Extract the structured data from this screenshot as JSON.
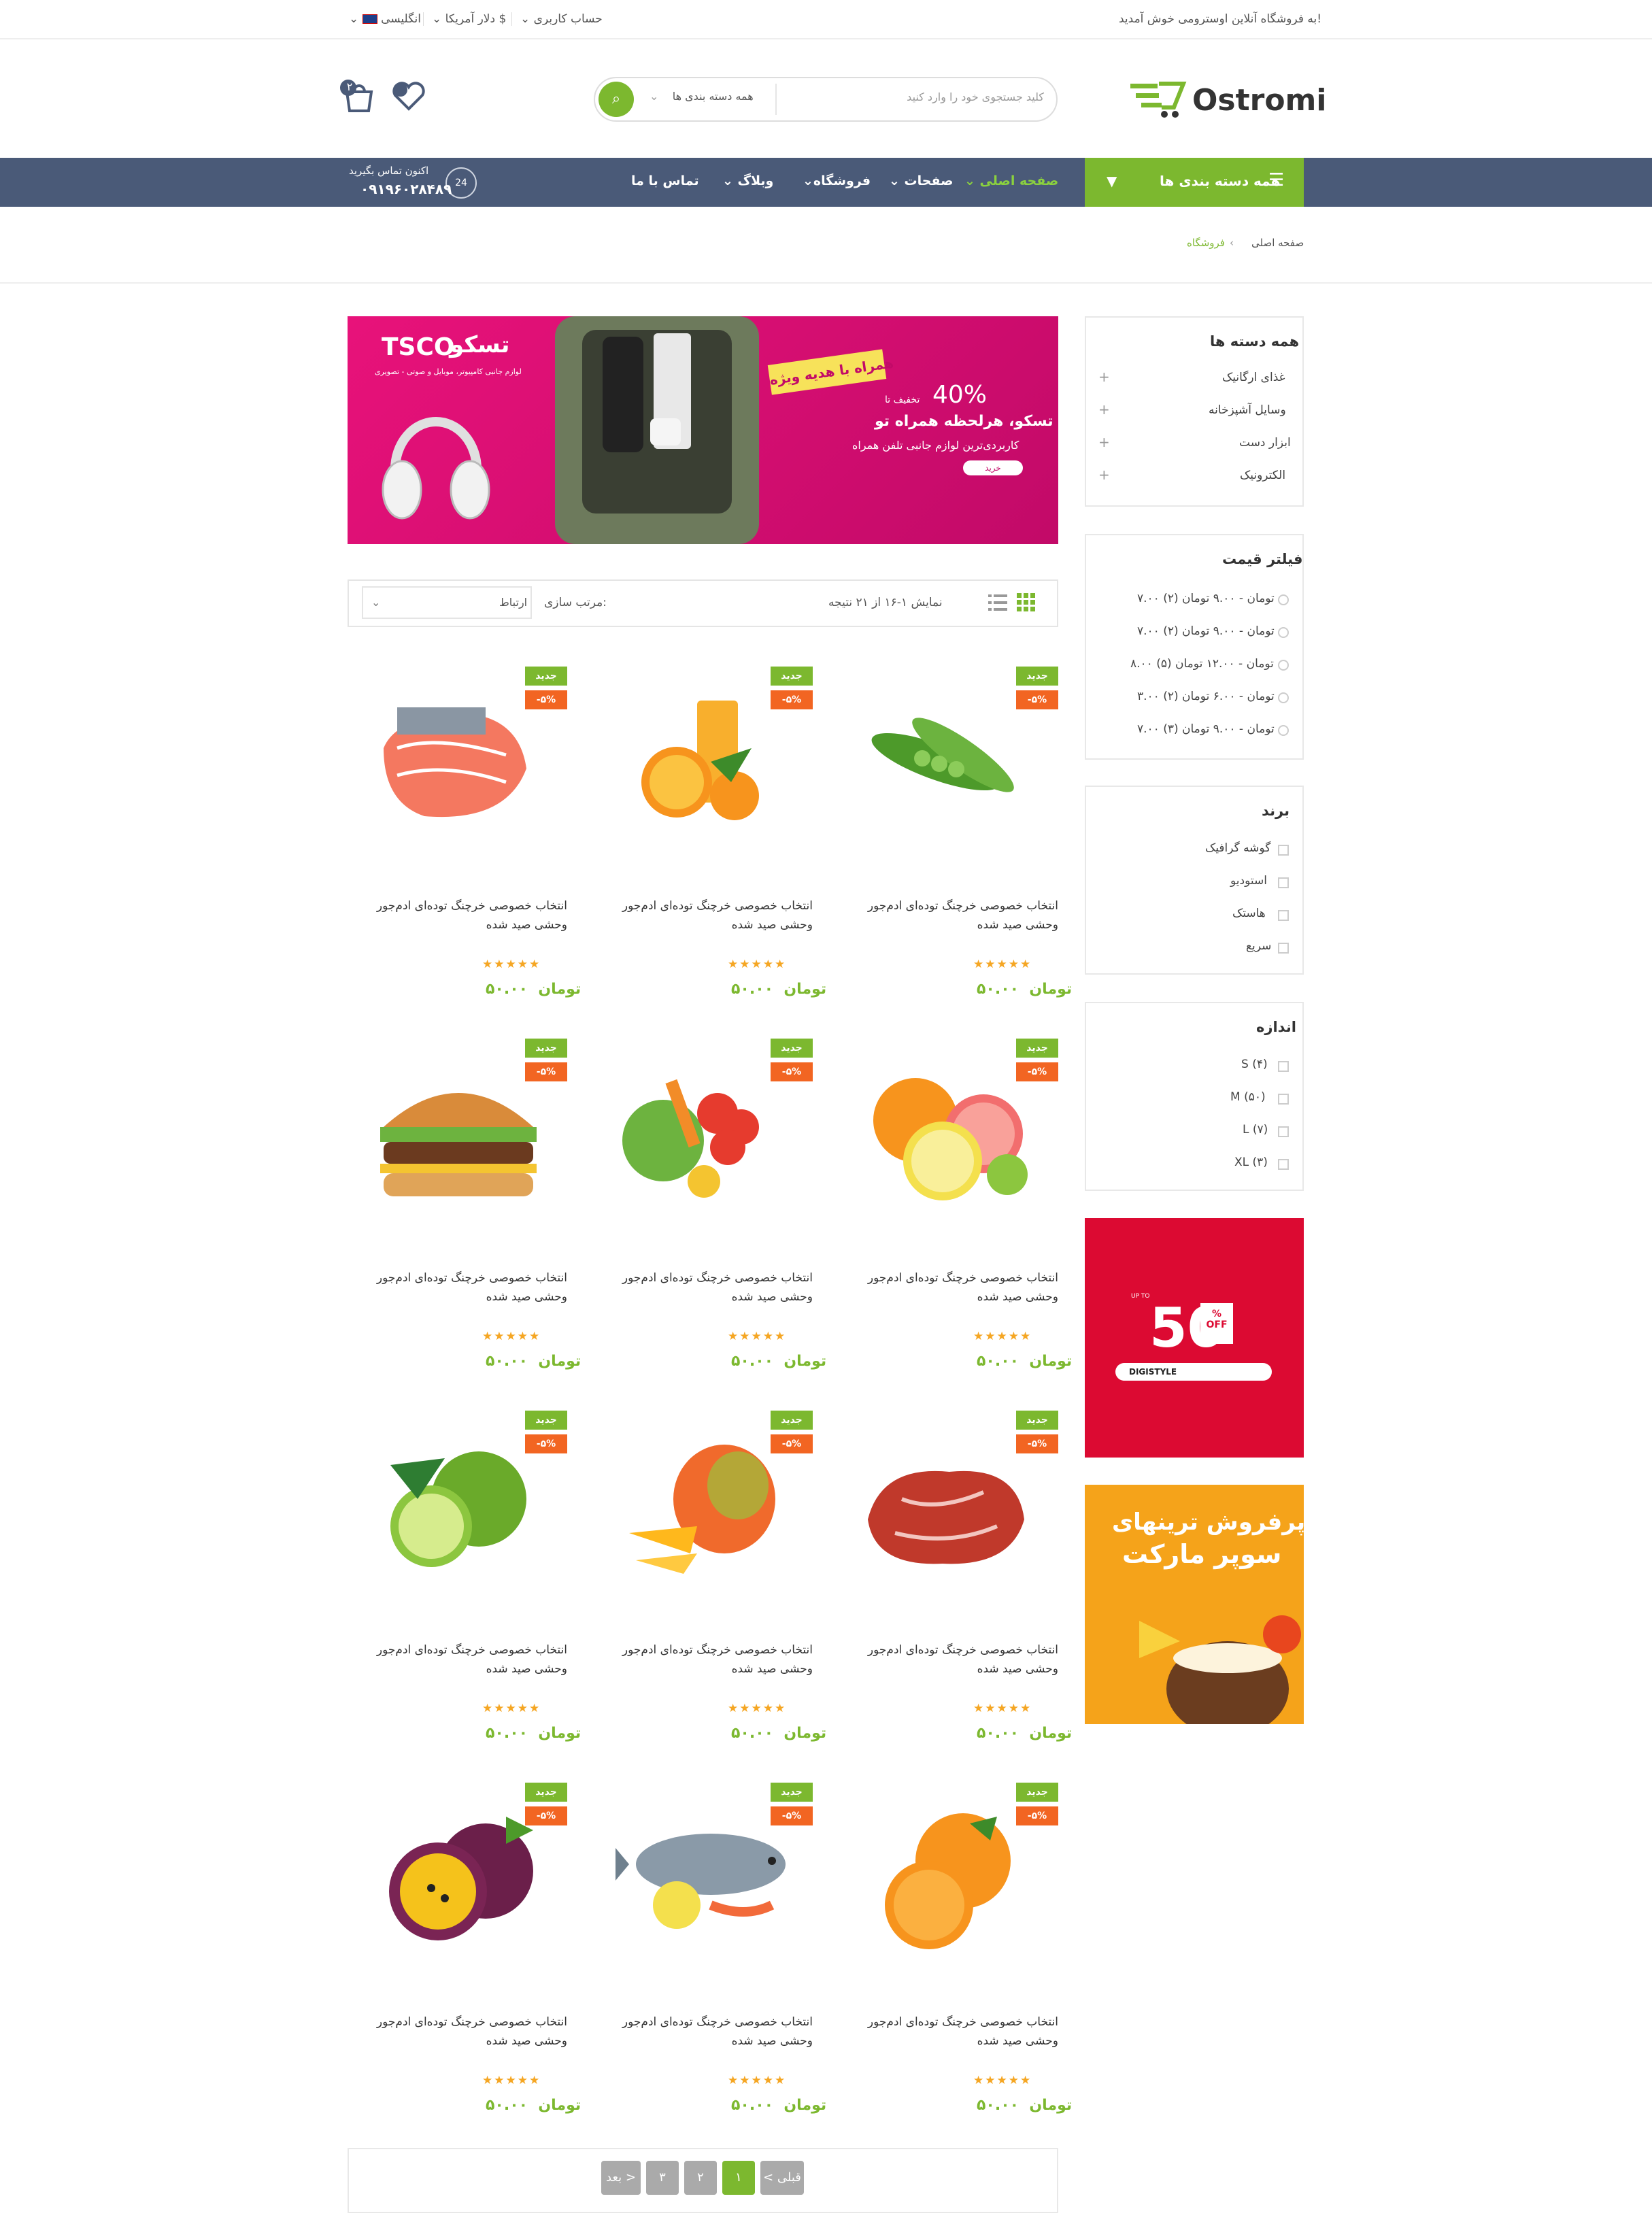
{
  "topbar": {
    "welcome": "به فروشگاه آنلاین اوسترومی خوش آمدید!",
    "language": "انگلیسی",
    "currency": "دلار آمریکا",
    "account": "حساب کاربری"
  },
  "header": {
    "logo": "Ostromi",
    "search_placeholder": "کلید جستجوی خود را وارد کنید",
    "search_category": "همه دسته بندی ها",
    "cart_count": "۲"
  },
  "nav": {
    "categories_label": "همه دسته بندی ها",
    "items": [
      "صفحه اصلی",
      "صفحات",
      "فروشگاه",
      "وبلاگ",
      "تماس با ما"
    ],
    "contact_label": "اکنون تماس بگیرید",
    "contact_phone": "۰۹۱۹۶۰۲۸۴۸۹",
    "contact_badge": "24"
  },
  "breadcrumb": {
    "home": "صفحه اصلی",
    "current": "فروشگاه"
  },
  "banner": {
    "brand": "تسکو",
    "brand_en": "TSCO",
    "brand_sub": "لوازم جانبی کامپیوتر، موبایل و صوتی - تصویری",
    "ribbon": "همراه با هدیه ویژه",
    "discount_prefix": "تخفیف تا",
    "discount": "40%",
    "headline": "تسکو، هرلحظه همراه تو",
    "sub": "کاربردی‌ترین لوازم جانبی تلفن همراه",
    "button": "خرید"
  },
  "toolbar": {
    "result": "نمایش ۱-۱۶ از ۲۱ نتیجه",
    "sort_label": "مرتب سازی:",
    "sort_value": "ارتباط"
  },
  "sidebar": {
    "categories": {
      "title": "همه دسته ها",
      "items": [
        "غذای ارگانیک",
        "وسایل آشپزخانه",
        "ابزار دست",
        "الکترونیک"
      ]
    },
    "price": {
      "title": "فیلتر قیمت",
      "items": [
        "۷.۰۰ تومان - ۹.۰۰ تومان (۲)",
        "۷.۰۰ تومان - ۹.۰۰ تومان (۲)",
        "۸.۰۰ تومان - ۱۲.۰۰ تومان (۵)",
        "۳.۰۰ تومان - ۶.۰۰ تومان (۲)",
        "۷.۰۰ تومان - ۹.۰۰ تومان (۳)"
      ]
    },
    "brand": {
      "title": "برند",
      "items": [
        "گوشه گرافیک",
        "استودیو",
        "هاستک",
        "سریع"
      ]
    },
    "size": {
      "title": "اندازه",
      "items": [
        "S (۴)",
        "M (۵۰)",
        "L (۷)",
        "XL (۳)"
      ]
    },
    "ad1": {
      "percent": "50",
      "off": "OFF",
      "upto": "UP TO",
      "brand": "DIGISTYLE"
    },
    "ad2": {
      "line1": "پرفروش ترینهای",
      "line2": "سوپر مارکت"
    }
  },
  "product": {
    "title_line1": "انتخاب خصوصی خرچنگ توده‌ای ادم‌جور",
    "title_line2": "وحشی صید شده",
    "badge_new": "جدید",
    "badge_off": "-۵%",
    "stars": "★★★★★",
    "price": "۵۰.۰۰",
    "currency": "تومان"
  },
  "products": [
    {
      "icon": "peas-icon"
    },
    {
      "icon": "orange-juice-icon"
    },
    {
      "icon": "salmon-icon"
    },
    {
      "icon": "citrus-icon"
    },
    {
      "icon": "vegetables-icon"
    },
    {
      "icon": "burger-icon"
    },
    {
      "icon": "meat-icon"
    },
    {
      "icon": "mango-icon"
    },
    {
      "icon": "lime-icon"
    },
    {
      "icon": "orange-icon"
    },
    {
      "icon": "fish-icon"
    },
    {
      "icon": "passion-fruit-icon"
    }
  ],
  "pagination": {
    "prev": "< قبلی",
    "pages": [
      "۱",
      "۲",
      "۳"
    ],
    "next": "بعد >"
  },
  "colors": {
    "accent": "#7cb82f",
    "nav": "#4a5a78",
    "orange": "#f26522",
    "banner": "#e8127a"
  }
}
